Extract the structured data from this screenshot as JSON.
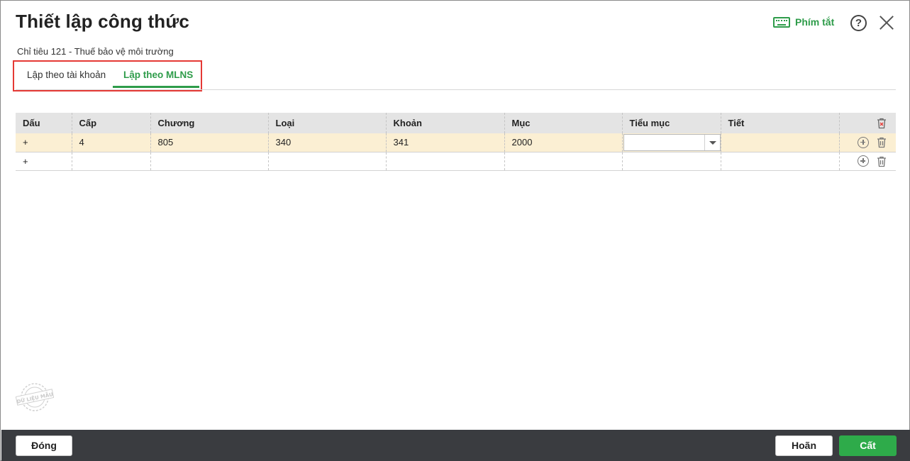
{
  "dialog": {
    "title": "Thiết lập công thức",
    "subtitle": "Chỉ tiêu 121 - Thuế bảo vệ môi trường",
    "shortcut_label": "Phím tắt",
    "help_label": "?"
  },
  "tabs": [
    {
      "label": "Lập theo tài khoản",
      "active": false
    },
    {
      "label": "Lập theo MLNS",
      "active": true
    }
  ],
  "grid": {
    "columns": [
      "Dấu",
      "Cấp",
      "Chương",
      "Loại",
      "Khoản",
      "Mục",
      "Tiểu mục",
      "Tiết"
    ],
    "rows": [
      {
        "dau": "+",
        "cap": "4",
        "chuong": "805",
        "loai": "340",
        "khoan": "341",
        "muc": "2000",
        "tieu_muc": "",
        "tiet": ""
      },
      {
        "dau": "+",
        "cap": "",
        "chuong": "",
        "loai": "",
        "khoan": "",
        "muc": "",
        "tieu_muc": "",
        "tiet": ""
      }
    ]
  },
  "watermark_text": "DỮ LIỆU MẪU",
  "footer": {
    "close_label": "Đóng",
    "cancel_label": "Hoãn",
    "save_label": "Cất"
  },
  "colors": {
    "accent": "#2e9c4a",
    "highlight_row": "#fbefd3",
    "footer_bg": "#3a3c40",
    "annotation_box": "#e53935"
  }
}
